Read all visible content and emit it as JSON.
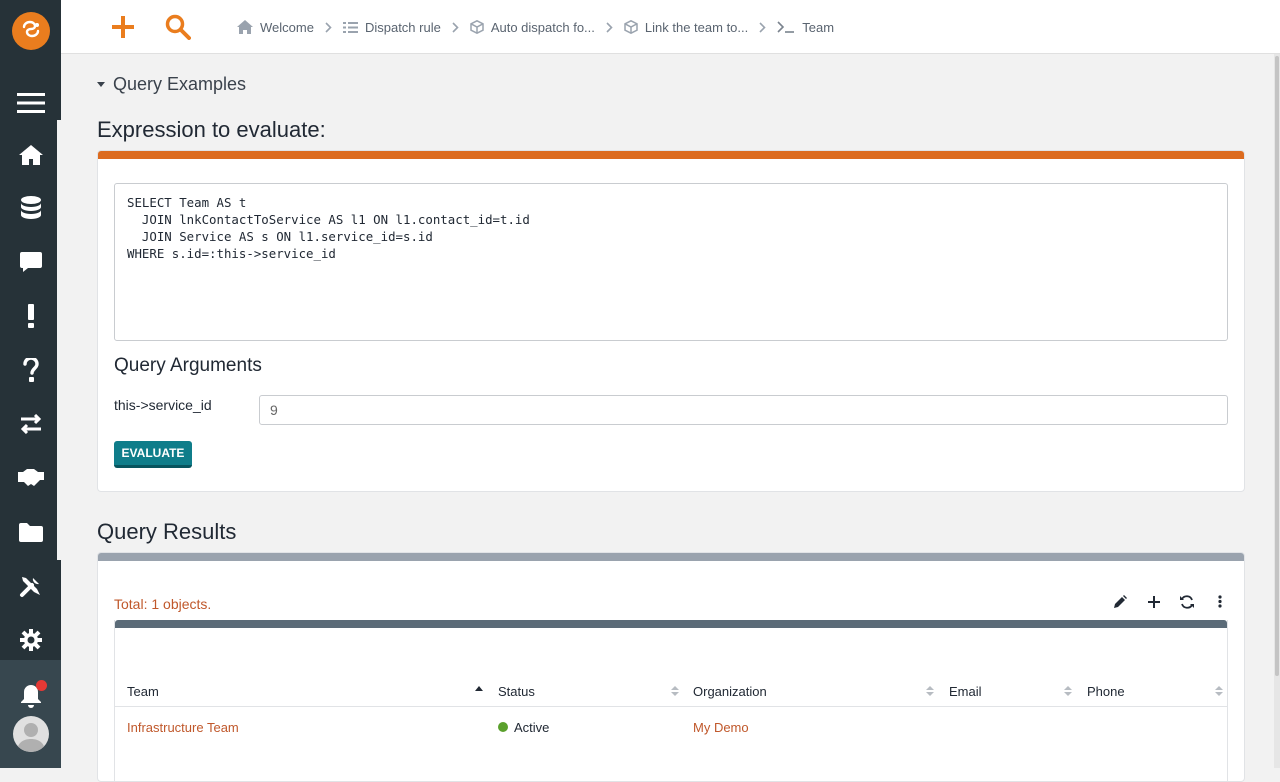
{
  "breadcrumb": [
    {
      "label": "Welcome",
      "icon": "home-icon"
    },
    {
      "label": "Dispatch rule",
      "icon": "list-icon"
    },
    {
      "label": "Auto dispatch fo...",
      "icon": "cube-icon"
    },
    {
      "label": "Link the team to...",
      "icon": "cube-icon"
    },
    {
      "label": "Team",
      "icon": "terminal-icon"
    }
  ],
  "query_examples": "Query Examples",
  "expression": {
    "title": "Expression to evaluate:",
    "code": "SELECT Team AS t\n  JOIN lnkContactToService AS l1 ON l1.contact_id=t.id\n  JOIN Service AS s ON l1.service_id=s.id\nWHERE s.id=:this->service_id"
  },
  "arguments": {
    "title": "Query Arguments",
    "label": "this->service_id",
    "value": "9"
  },
  "evaluate_label": "EVALUATE",
  "results": {
    "title": "Query Results",
    "total": "Total: 1 objects.",
    "columns": [
      "Team",
      "Status",
      "Organization",
      "Email",
      "Phone"
    ],
    "rows": [
      {
        "team": "Infrastructure Team",
        "status": "Active",
        "organization": "My Demo",
        "email": "",
        "phone": ""
      }
    ]
  },
  "colors": {
    "accent": "#dc6b1f",
    "button": "#0f7d8a",
    "sidebar": "#263238",
    "status_active": "#5aa02c"
  }
}
